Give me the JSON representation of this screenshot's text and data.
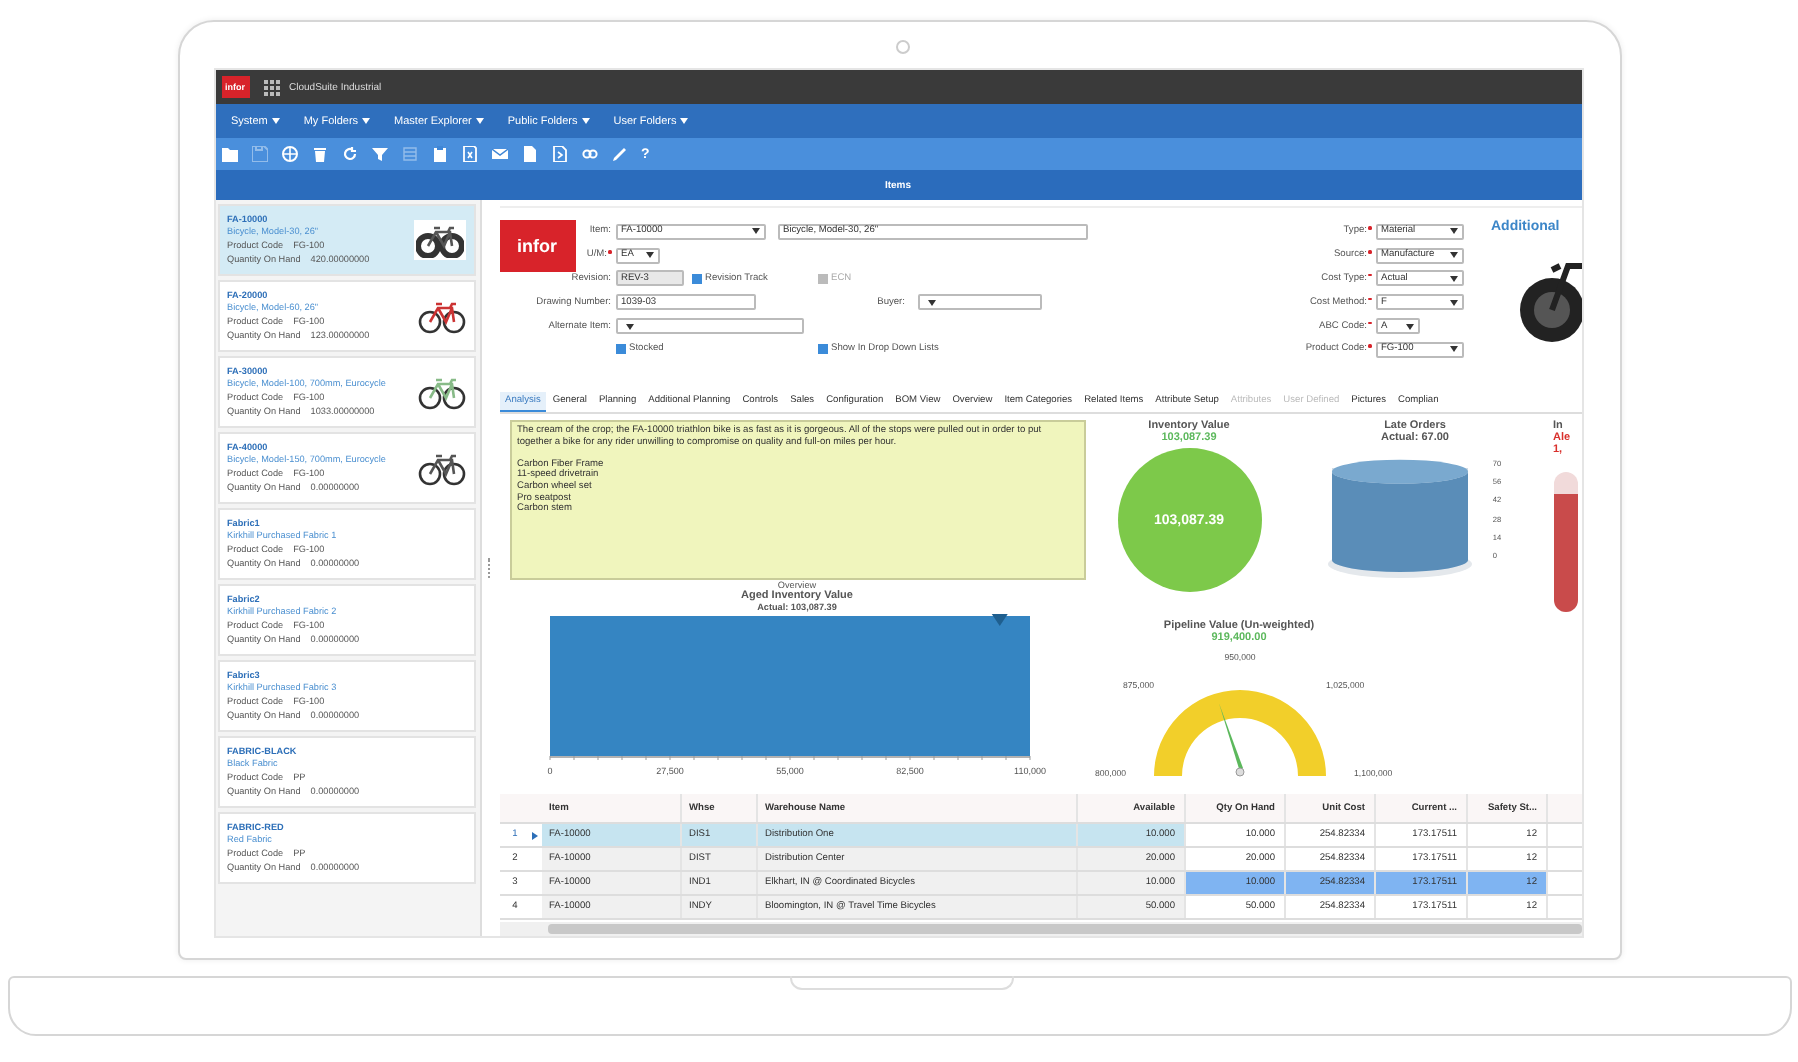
{
  "app": {
    "logo": "infor",
    "title": "CloudSuite Industrial"
  },
  "menu": [
    {
      "label": "System"
    },
    {
      "label": "My Folders"
    },
    {
      "label": "Master Explorer"
    },
    {
      "label": "Public Folders"
    },
    {
      "label": "User Folders"
    }
  ],
  "toolbar": [
    {
      "kind": "folder",
      "disabled": false
    },
    {
      "kind": "save",
      "disabled": true
    },
    {
      "kind": "globe",
      "disabled": false
    },
    {
      "kind": "trash",
      "disabled": false
    },
    {
      "kind": "refresh",
      "disabled": false
    },
    {
      "kind": "filter",
      "disabled": false
    },
    {
      "kind": "grid",
      "disabled": true
    },
    {
      "kind": "clipboard",
      "disabled": false
    },
    {
      "kind": "spreadsheet",
      "disabled": false
    },
    {
      "kind": "mail",
      "disabled": false
    },
    {
      "kind": "document",
      "disabled": false
    },
    {
      "kind": "export",
      "disabled": false
    },
    {
      "kind": "link",
      "disabled": false
    },
    {
      "kind": "pencil",
      "disabled": false
    },
    {
      "kind": "help",
      "label": "?",
      "disabled": false
    }
  ],
  "page_title": "Items",
  "item_list": [
    {
      "code": "FA-10000",
      "description": "Bicycle, Model-30, 26\"",
      "product_code_label": "Product Code",
      "product_code": "FG-100",
      "qty_label": "Quantity On Hand",
      "qty": "420.00000000",
      "picture": true,
      "selected": true
    },
    {
      "code": "FA-20000",
      "description": "Bicycle, Model-60, 26\"",
      "product_code_label": "Product Code",
      "product_code": "FG-100",
      "qty_label": "Quantity On Hand",
      "qty": "123.00000000",
      "picture": true,
      "selected": false
    },
    {
      "code": "FA-30000",
      "description": "Bicycle, Model-100, 700mm, Eurocycle",
      "product_code_label": "Product Code",
      "product_code": "FG-100",
      "qty_label": "Quantity On Hand",
      "qty": "1033.00000000",
      "picture": true,
      "selected": false
    },
    {
      "code": "FA-40000",
      "description": "Bicycle, Model-150, 700mm, Eurocycle",
      "product_code_label": "Product Code",
      "product_code": "FG-100",
      "qty_label": "Quantity On Hand",
      "qty": "0.00000000",
      "picture": true,
      "selected": false
    },
    {
      "code": "Fabric1",
      "description": "Kirkhill Purchased Fabric 1",
      "product_code_label": "Product Code",
      "product_code": "FG-100",
      "qty_label": "Quantity On Hand",
      "qty": "0.00000000",
      "picture": false,
      "selected": false
    },
    {
      "code": "Fabric2",
      "description": "Kirkhill Purchased Fabric 2",
      "product_code_label": "Product Code",
      "product_code": "FG-100",
      "qty_label": "Quantity On Hand",
      "qty": "0.00000000",
      "picture": false,
      "selected": false
    },
    {
      "code": "Fabric3",
      "description": "Kirkhill Purchased Fabric 3",
      "product_code_label": "Product Code",
      "product_code": "FG-100",
      "qty_label": "Quantity On Hand",
      "qty": "0.00000000",
      "picture": false,
      "selected": false
    },
    {
      "code": "FABRIC-BLACK",
      "description": "Black Fabric",
      "product_code_label": "Product Code",
      "product_code": "PP",
      "qty_label": "Quantity On Hand",
      "qty": "0.00000000",
      "picture": false,
      "selected": false
    },
    {
      "code": "FABRIC-RED",
      "description": "Red Fabric",
      "product_code_label": "Product Code",
      "product_code": "PP",
      "qty_label": "Quantity On Hand",
      "qty": "0.00000000",
      "picture": false,
      "selected": false
    }
  ],
  "form": {
    "logo": "infor",
    "item": {
      "label": "Item:",
      "value": "FA-10000",
      "description": "Bicycle, Model-30, 26\""
    },
    "um": {
      "label": "U/M:",
      "required": true,
      "value": "EA"
    },
    "revision": {
      "label": "Revision:",
      "value": "REV-3"
    },
    "revision_track": {
      "label": "Revision Track",
      "checked": true,
      "disabled": false
    },
    "ecn": {
      "label": "ECN",
      "checked": true,
      "disabled": true
    },
    "drawing_number": {
      "label": "Drawing Number:",
      "value": "1039-03"
    },
    "buyer": {
      "label": "Buyer:"
    },
    "alternate_item": {
      "label": "Alternate Item:"
    },
    "stocked": {
      "label": "Stocked",
      "checked": true,
      "disabled": false
    },
    "show_in_lists": {
      "label": "Show In Drop Down Lists",
      "checked": true,
      "disabled": false
    },
    "right_fields": [
      {
        "label": "Type:",
        "required": true,
        "value": "Material"
      },
      {
        "label": "Source:",
        "required": true,
        "value": "Manufacture"
      },
      {
        "label": "Cost Type:",
        "required": true,
        "value": "Actual"
      },
      {
        "label": "Cost Method:",
        "required": true,
        "value": "F"
      },
      {
        "label": "ABC Code:",
        "required": true,
        "value": "A"
      },
      {
        "label": "Product Code:",
        "required": true,
        "value": "FG-100"
      }
    ],
    "additional": "Additional"
  },
  "tabs": [
    {
      "label": "Analysis",
      "selected": true,
      "disabled": false
    },
    {
      "label": "General",
      "selected": false,
      "disabled": false
    },
    {
      "label": "Planning",
      "selected": false,
      "disabled": false
    },
    {
      "label": "Additional Planning",
      "selected": false,
      "disabled": false
    },
    {
      "label": "Controls",
      "selected": false,
      "disabled": false
    },
    {
      "label": "Sales",
      "selected": false,
      "disabled": false
    },
    {
      "label": "Configuration",
      "selected": false,
      "disabled": false
    },
    {
      "label": "BOM View",
      "selected": false,
      "disabled": false
    },
    {
      "label": "Overview",
      "selected": false,
      "disabled": false
    },
    {
      "label": "Item Categories",
      "selected": false,
      "disabled": false
    },
    {
      "label": "Related Items",
      "selected": false,
      "disabled": false
    },
    {
      "label": "Attribute Setup",
      "selected": false,
      "disabled": false
    },
    {
      "label": "Attributes",
      "selected": false,
      "disabled": true
    },
    {
      "label": "User Defined",
      "selected": false,
      "disabled": true
    },
    {
      "label": "Pictures",
      "selected": false,
      "disabled": false
    },
    {
      "label": "Complian",
      "selected": false,
      "disabled": false
    }
  ],
  "notes": {
    "paragraph": "The cream of the crop; the FA-10000 triathlon bike is as fast as it is gorgeous. All of the stops were pulled out in order to put together a bike for any rider unwilling to compromise on quality and full-on miles per hour.",
    "lines": [
      "Carbon Fiber Frame",
      "11-speed drivetrain",
      "Carbon wheel set",
      "Pro seatpost",
      "Carbon stem"
    ],
    "caption": "Overview"
  },
  "aged_inventory": {
    "title": "Aged Inventory Value",
    "subtitle": "Actual: 103,087.39",
    "level": 0.937,
    "tick_labels": [
      "0",
      "27,500",
      "55,000",
      "82,500",
      "110,000"
    ]
  },
  "inventory_value": {
    "title": "Inventory Value",
    "value": "103,087.39",
    "center_label": "103,087.39"
  },
  "late_orders": {
    "title": "Late Orders",
    "subtitle": "Actual: 67.00",
    "level": 0.96,
    "axis_labels": [
      "70",
      "56",
      "42",
      "28",
      "14",
      "0"
    ]
  },
  "thermometer": {
    "title": "In",
    "alert": "Ale",
    "value": "1,",
    "level": 0.85
  },
  "pipeline": {
    "title": "Pipeline Value (Un-weighted)",
    "value": "919,400.00",
    "level": 0.4,
    "tick_labels": [
      "800,000",
      "875,000",
      "950,000",
      "1,025,000",
      "1,100,000"
    ]
  },
  "grid": {
    "columns": [
      "Item",
      "Whse",
      "Warehouse Name",
      "Available",
      "Qty On Hand",
      "Unit Cost",
      "Current ...",
      "Safety St..."
    ],
    "rows": [
      {
        "number": "1",
        "selected": true,
        "cells": [
          {
            "text": "FA-10000",
            "selected": false
          },
          {
            "text": "DIS1",
            "selected": false
          },
          {
            "text": "Distribution One",
            "selected": false
          },
          {
            "text": "10.000",
            "selected": false
          },
          {
            "text": "10.000",
            "selected": false
          },
          {
            "text": "254.82334",
            "selected": false
          },
          {
            "text": "173.17511",
            "selected": false
          },
          {
            "text": "12",
            "selected": false
          }
        ]
      },
      {
        "number": "2",
        "selected": false,
        "cells": [
          {
            "text": "FA-10000",
            "selected": false
          },
          {
            "text": "DIST",
            "selected": false
          },
          {
            "text": "Distribution Center",
            "selected": false
          },
          {
            "text": "20.000",
            "selected": false
          },
          {
            "text": "20.000",
            "selected": false
          },
          {
            "text": "254.82334",
            "selected": false
          },
          {
            "text": "173.17511",
            "selected": false
          },
          {
            "text": "12",
            "selected": false
          }
        ]
      },
      {
        "number": "3",
        "selected": false,
        "cells": [
          {
            "text": "FA-10000",
            "selected": false
          },
          {
            "text": "IND1",
            "selected": false
          },
          {
            "text": "Elkhart, IN @ Coordinated Bicycles",
            "selected": false
          },
          {
            "text": "10.000",
            "selected": false
          },
          {
            "text": "10.000",
            "selected": true
          },
          {
            "text": "254.82334",
            "selected": true
          },
          {
            "text": "173.17511",
            "selected": true
          },
          {
            "text": "12",
            "selected": true
          }
        ]
      },
      {
        "number": "4",
        "selected": false,
        "cells": [
          {
            "text": "FA-10000",
            "selected": false
          },
          {
            "text": "INDY",
            "selected": false
          },
          {
            "text": "Bloomington, IN @ Travel Time Bicycles",
            "selected": false
          },
          {
            "text": "50.000",
            "selected": false
          },
          {
            "text": "50.000",
            "selected": false
          },
          {
            "text": "254.82334",
            "selected": false
          },
          {
            "text": "173.17511",
            "selected": false
          },
          {
            "text": "12",
            "selected": false
          }
        ]
      }
    ]
  }
}
